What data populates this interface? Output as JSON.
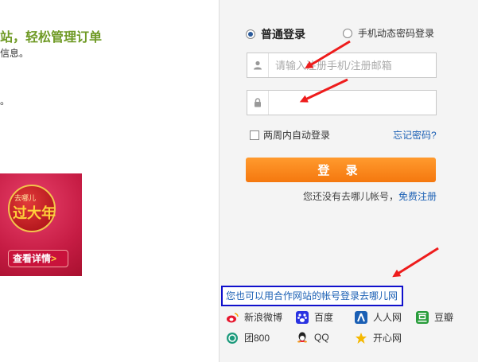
{
  "left": {
    "promo_title": "站，轻松管理订单",
    "promo_sub": "信息。",
    "promo_dot": "。",
    "banner": {
      "small_text": "去哪儿",
      "big_text": "过大年",
      "button_label": "查看详情",
      "button_chevron": ">"
    }
  },
  "login": {
    "tabs": [
      {
        "label": "普通登录",
        "selected": true
      },
      {
        "label": "手机动态密码登录",
        "selected": false
      }
    ],
    "username_placeholder": "请输入注册手机/注册邮箱",
    "password_value": "",
    "remember_label": "两周内自动登录",
    "forgot_label": "忘记密码?",
    "login_button": "登 录",
    "no_account_text": "您还没有去哪儿帐号，",
    "register_label": "免费注册"
  },
  "partners": {
    "title": "您也可以用合作网站的帐号登录去哪儿网",
    "items": [
      {
        "label": "新浪微博",
        "icon": "weibo-icon",
        "color": "#e6162d"
      },
      {
        "label": "百度",
        "icon": "baidu-icon",
        "color": "#2932e1"
      },
      {
        "label": "人人网",
        "icon": "renren-icon",
        "color": "#1a5fb4"
      },
      {
        "label": "豆瓣",
        "icon": "douban-icon",
        "color": "#2a9d3c"
      },
      {
        "label": "团800",
        "icon": "tuan800-icon",
        "color": "#1c9a7c"
      },
      {
        "label": "QQ",
        "icon": "qq-icon",
        "color": "#f0a020"
      },
      {
        "label": "开心网",
        "icon": "kaixin-icon",
        "color": "#f5b800"
      }
    ]
  },
  "colors": {
    "accent_orange": "#f5780f",
    "link_blue": "#1a5fb4",
    "highlight_border": "#1010cc",
    "arrow_red": "#ee1c1c"
  }
}
